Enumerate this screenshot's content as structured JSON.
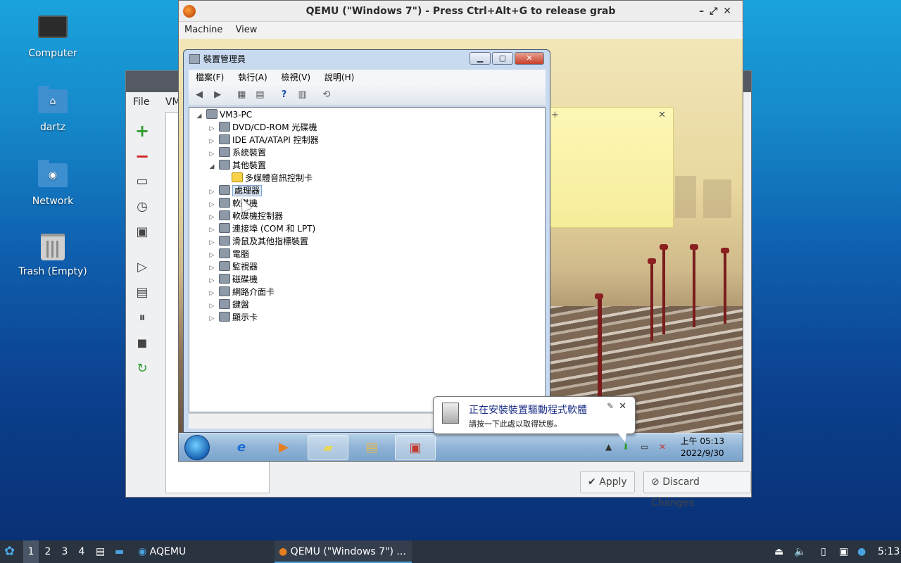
{
  "desktop": {
    "icons": [
      {
        "label": "Computer",
        "icon": "computer-icon"
      },
      {
        "label": "dartz",
        "icon": "home-folder-icon"
      },
      {
        "label": "Network",
        "icon": "network-folder-icon"
      },
      {
        "label": "Trash (Empty)",
        "icon": "trash-icon"
      }
    ]
  },
  "aqemu": {
    "menu": [
      "File",
      "VM"
    ],
    "buttons": {
      "apply": "Apply",
      "discard": "Discard Changes"
    }
  },
  "qemu": {
    "title": "QEMU (\"Windows 7\") - Press Ctrl+Alt+G to release grab",
    "menu": [
      "Machine",
      "View"
    ]
  },
  "devmgr": {
    "title": "裝置管理員",
    "menu": [
      "檔案(F)",
      "執行(A)",
      "檢視(V)",
      "說明(H)"
    ],
    "root": "VM3-PC",
    "items": [
      {
        "label": "DVD/CD-ROM 光碟機",
        "expander": "▷"
      },
      {
        "label": "IDE ATA/ATAPI 控制器",
        "expander": "▷"
      },
      {
        "label": "系統裝置",
        "expander": "▷"
      },
      {
        "label": "其他裝置",
        "expander": "◢"
      },
      {
        "label": "多媒體音訊控制卡",
        "expander": "",
        "child": true,
        "warn": true
      },
      {
        "label": "處理器",
        "expander": "▷",
        "selected": true
      },
      {
        "label": "軟碟機",
        "expander": "▷"
      },
      {
        "label": "軟碟機控制器",
        "expander": "▷"
      },
      {
        "label": "連接埠 (COM 和 LPT)",
        "expander": "▷"
      },
      {
        "label": "滑鼠及其他指標裝置",
        "expander": "▷"
      },
      {
        "label": "電腦",
        "expander": "▷"
      },
      {
        "label": "監視器",
        "expander": "▷"
      },
      {
        "label": "磁碟機",
        "expander": "▷"
      },
      {
        "label": "網路介面卡",
        "expander": "▷"
      },
      {
        "label": "鍵盤",
        "expander": "▷"
      },
      {
        "label": "顯示卡",
        "expander": "▷"
      }
    ]
  },
  "balloon": {
    "title": "正在安裝裝置驅動程式軟體",
    "subtitle": "請按一下此處以取得狀態。"
  },
  "win_taskbar": {
    "time": "上午 05:13",
    "date": "2022/9/30"
  },
  "panel": {
    "workspaces": [
      "1",
      "2",
      "3",
      "4"
    ],
    "tasks": [
      "AQEMU",
      "QEMU (\"Windows 7\") ..."
    ],
    "clock": "5:13"
  }
}
